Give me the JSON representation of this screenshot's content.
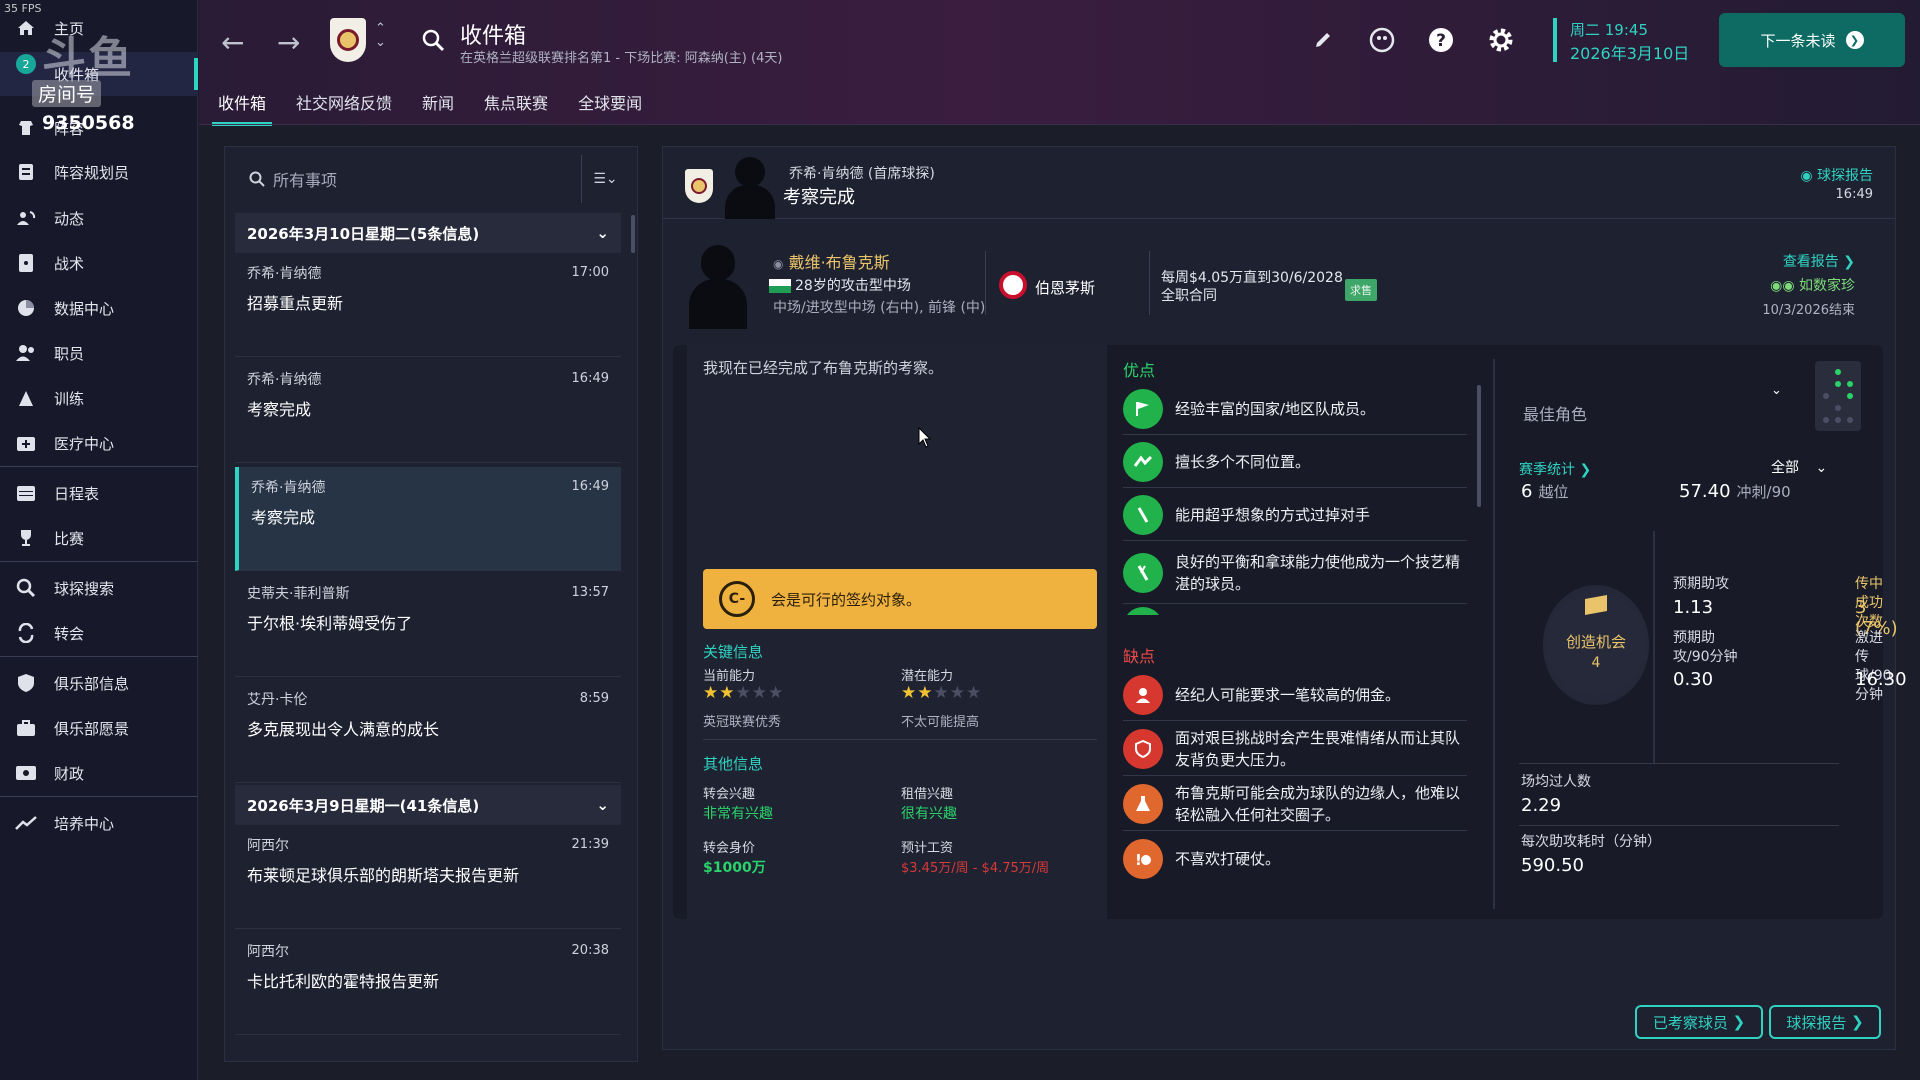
{
  "app": {
    "fps": "35 FPS"
  },
  "watermark": {
    "big": "斗鱼",
    "room_label": "房间号",
    "room_number": "9350568"
  },
  "sidebar": {
    "inbox_badge": "2",
    "items": [
      {
        "label": "主页",
        "icon": "home-icon"
      },
      {
        "label": "收件箱",
        "icon": "inbox-icon"
      },
      {
        "label": "阵容",
        "icon": "squad-icon"
      },
      {
        "label": "阵容规划员",
        "icon": "planner-icon"
      },
      {
        "label": "动态",
        "icon": "dynamics-icon"
      },
      {
        "label": "战术",
        "icon": "tactics-icon"
      },
      {
        "label": "数据中心",
        "icon": "data-hub-icon"
      },
      {
        "label": "职员",
        "icon": "staff-icon"
      },
      {
        "label": "训练",
        "icon": "training-icon"
      },
      {
        "label": "医疗中心",
        "icon": "medical-icon"
      },
      {
        "label": "日程表",
        "icon": "schedule-icon"
      },
      {
        "label": "比赛",
        "icon": "trophy-icon"
      },
      {
        "label": "球探搜索",
        "icon": "search-icon"
      },
      {
        "label": "转会",
        "icon": "transfer-icon"
      },
      {
        "label": "俱乐部信息",
        "icon": "shield-icon"
      },
      {
        "label": "俱乐部愿景",
        "icon": "vision-icon"
      },
      {
        "label": "财政",
        "icon": "finance-icon"
      },
      {
        "label": "培养中心",
        "icon": "development-icon"
      }
    ]
  },
  "header": {
    "title": "收件箱",
    "subtitle": "在英格兰超级联赛排名第1 - 下场比赛: 阿森纳(主) (4天)",
    "tabs": [
      "收件箱",
      "社交网络反馈",
      "新闻",
      "焦点联赛",
      "全球要闻"
    ],
    "date_line1": "周二 19:45",
    "date_line2": "2026年3月10日",
    "next_button": "下一条未读"
  },
  "inbox": {
    "search_placeholder": "所有事项",
    "groups": [
      {
        "title": "2026年3月10日星期二(5条信息)"
      },
      {
        "title": "2026年3月9日星期一(41条信息)"
      }
    ],
    "messages": [
      {
        "from": "乔希·肯纳德",
        "time": "17:00",
        "subject": "招募重点更新"
      },
      {
        "from": "乔希·肯纳德",
        "time": "16:49",
        "subject": "考察完成"
      },
      {
        "from": "乔希·肯纳德",
        "time": "16:49",
        "subject": "考察完成"
      },
      {
        "from": "史蒂夫·菲利普斯",
        "time": "13:57",
        "subject": "于尔根·埃利蒂姆受伤了"
      },
      {
        "from": "艾丹·卡伦",
        "time": "8:59",
        "subject": "多克展现出令人满意的成长"
      },
      {
        "from": "阿西尔",
        "time": "21:39",
        "subject": "布莱顿足球俱乐部的朗斯塔夫报告更新"
      },
      {
        "from": "阿西尔",
        "time": "20:38",
        "subject": "卡比托利欧的霍特报告更新"
      }
    ]
  },
  "detail": {
    "from": "乔希·肯纳德 (首席球探)",
    "subject": "考察完成",
    "report_link": "球探报告",
    "time": "16:49",
    "player": {
      "name": "戴维·布鲁克斯",
      "age_role": "28岁的攻击型中场",
      "positions": "中场/进攻型中场 (右中), 前锋 (中)",
      "club": "伯恩茅斯",
      "wage_line1": "每周$4.05万直到30/6/2028",
      "wage_line2": "全职合同",
      "sale_tag": "求售",
      "view_report": "查看报告",
      "tag": "如数家珍",
      "end_date": "10/3/2026结束"
    },
    "quote": "我现在已经完成了布鲁克斯的考察。",
    "verdict_grade": "C-",
    "verdict_text": "会是可行的签约对象。",
    "key_info_title": "关键信息",
    "current_ability_label": "当前能力",
    "current_ability_stars": 2,
    "current_ability_note": "英冠联赛优秀",
    "potential_ability_label": "潜在能力",
    "potential_ability_stars": 2,
    "potential_ability_note": "不太可能提高",
    "other_info_title": "其他信息",
    "transfer_interest_label": "转会兴趣",
    "transfer_interest_value": "非常有兴趣",
    "loan_interest_label": "租借兴趣",
    "loan_interest_value": "很有兴趣",
    "value_label": "转会身价",
    "value_value": "$1000万",
    "wage_label": "预计工资",
    "wage_value": "$3.45万/周 - $4.75万/周",
    "pros_title": "优点",
    "pros": [
      "经验丰富的国家/地区队成员。",
      "擅长多个不同位置。",
      "能用超乎想象的方式过掉对手",
      "良好的平衡和拿球能力使他成为一个技艺精湛的球员。"
    ],
    "cons_title": "缺点",
    "cons": [
      "经纪人可能要求一笔较高的佣金。",
      "面对艰巨挑战时会产生畏难情绪从而让其队友背负更大压力。",
      "布鲁克斯可能会成为球队的边缘人，他难以轻松融入任何社交圈子。",
      "不喜欢打硬仗。"
    ],
    "best_role_label": "最佳角色",
    "season_stats_label": "赛季统计",
    "filter_all": "全部",
    "offsides_value": "6",
    "offsides_label": "越位",
    "sprints_value": "57.40",
    "sprints_label": "冲刺/90",
    "chances_label": "创造机会",
    "chances_value": "4",
    "xa_label": "预期助攻",
    "xa_value": "1.13",
    "crosses_label": "传中成功次数",
    "crosses_value": "3 (7%)",
    "xa90_label1": "预期助",
    "xa90_label2": "攻/90分钟",
    "xa90_value": "0.30",
    "prog_label1": "激进传",
    "prog_label2": "球/90分钟",
    "prog_value": "16.30",
    "dribbles_label": "场均过人数",
    "dribbles_value": "2.29",
    "minutes_per_assist_label": "每次助攻耗时（分钟）",
    "minutes_per_assist_value": "590.50",
    "btn_scouted": "已考察球员",
    "btn_report": "球探报告"
  }
}
